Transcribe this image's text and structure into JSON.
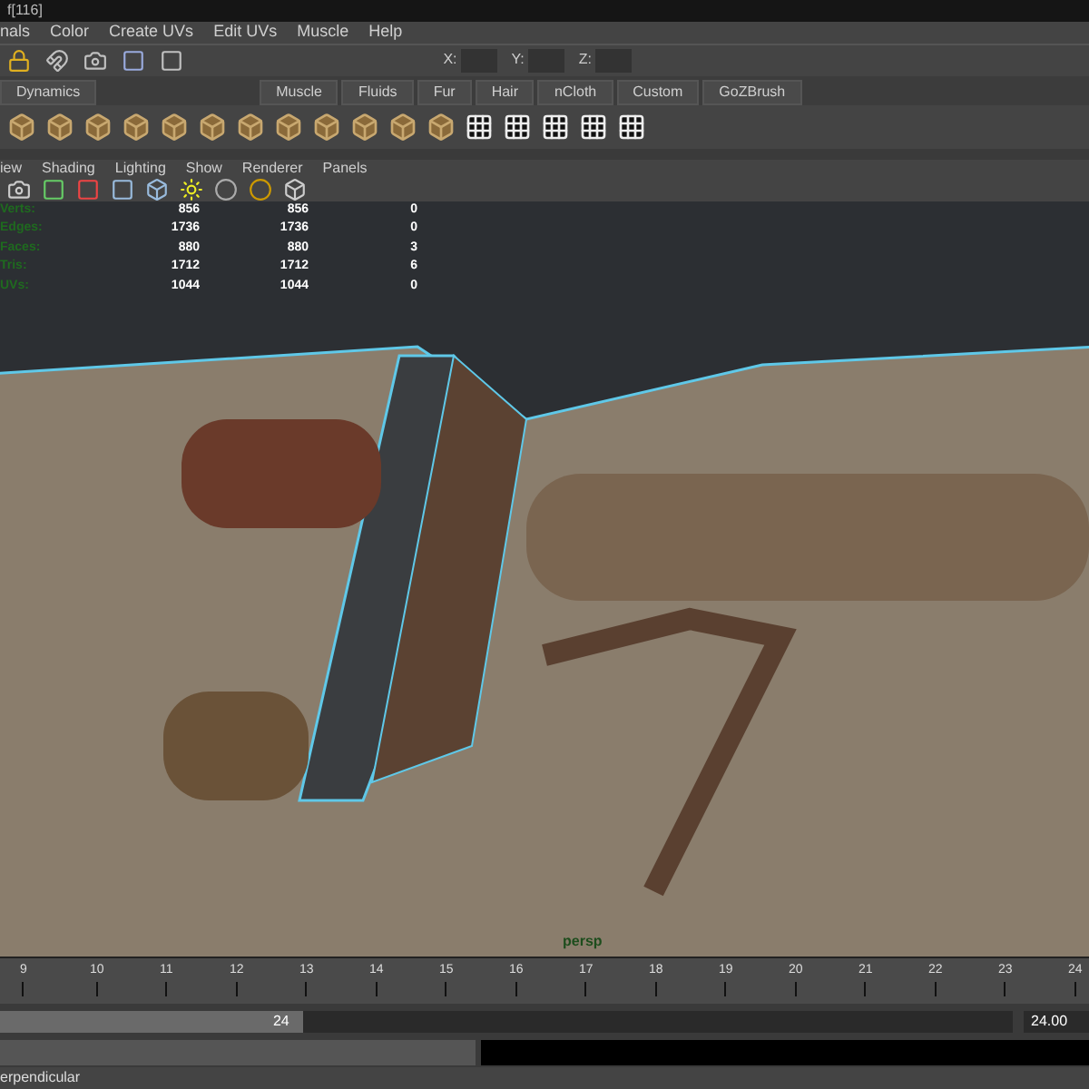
{
  "window": {
    "title": "f[116]"
  },
  "menu": [
    "nals",
    "Color",
    "Create UVs",
    "Edit UVs",
    "Muscle",
    "Help"
  ],
  "coordinate_fields": [
    "X:",
    "Y:",
    "Z:"
  ],
  "shelf_tabs": [
    "Dynamics",
    "Muscle",
    "Fluids",
    "Fur",
    "Hair",
    "nCloth",
    "Custom",
    "GoZBrush"
  ],
  "panel_menu": [
    "iew",
    "Shading",
    "Lighting",
    "Show",
    "Renderer",
    "Panels"
  ],
  "hud": [
    {
      "label": "Verts:",
      "values": [
        "856",
        "856",
        "0"
      ]
    },
    {
      "label": "Edges:",
      "values": [
        "1736",
        "1736",
        "0"
      ]
    },
    {
      "label": "Faces:",
      "values": [
        "880",
        "880",
        "3"
      ]
    },
    {
      "label": "Tris:",
      "values": [
        "1712",
        "1712",
        "6"
      ]
    },
    {
      "label": "UVs:",
      "values": [
        "1044",
        "1044",
        "0"
      ]
    }
  ],
  "viewport": {
    "camera": "persp"
  },
  "timeline": {
    "ticks": [
      "9",
      "10",
      "11",
      "12",
      "13",
      "14",
      "15",
      "16",
      "17",
      "18",
      "19",
      "20",
      "21",
      "22",
      "23",
      "24"
    ]
  },
  "range_slider": {
    "end_value": "24",
    "level": 0.3,
    "current_time": "24.00"
  },
  "help_line": "erpendicular"
}
